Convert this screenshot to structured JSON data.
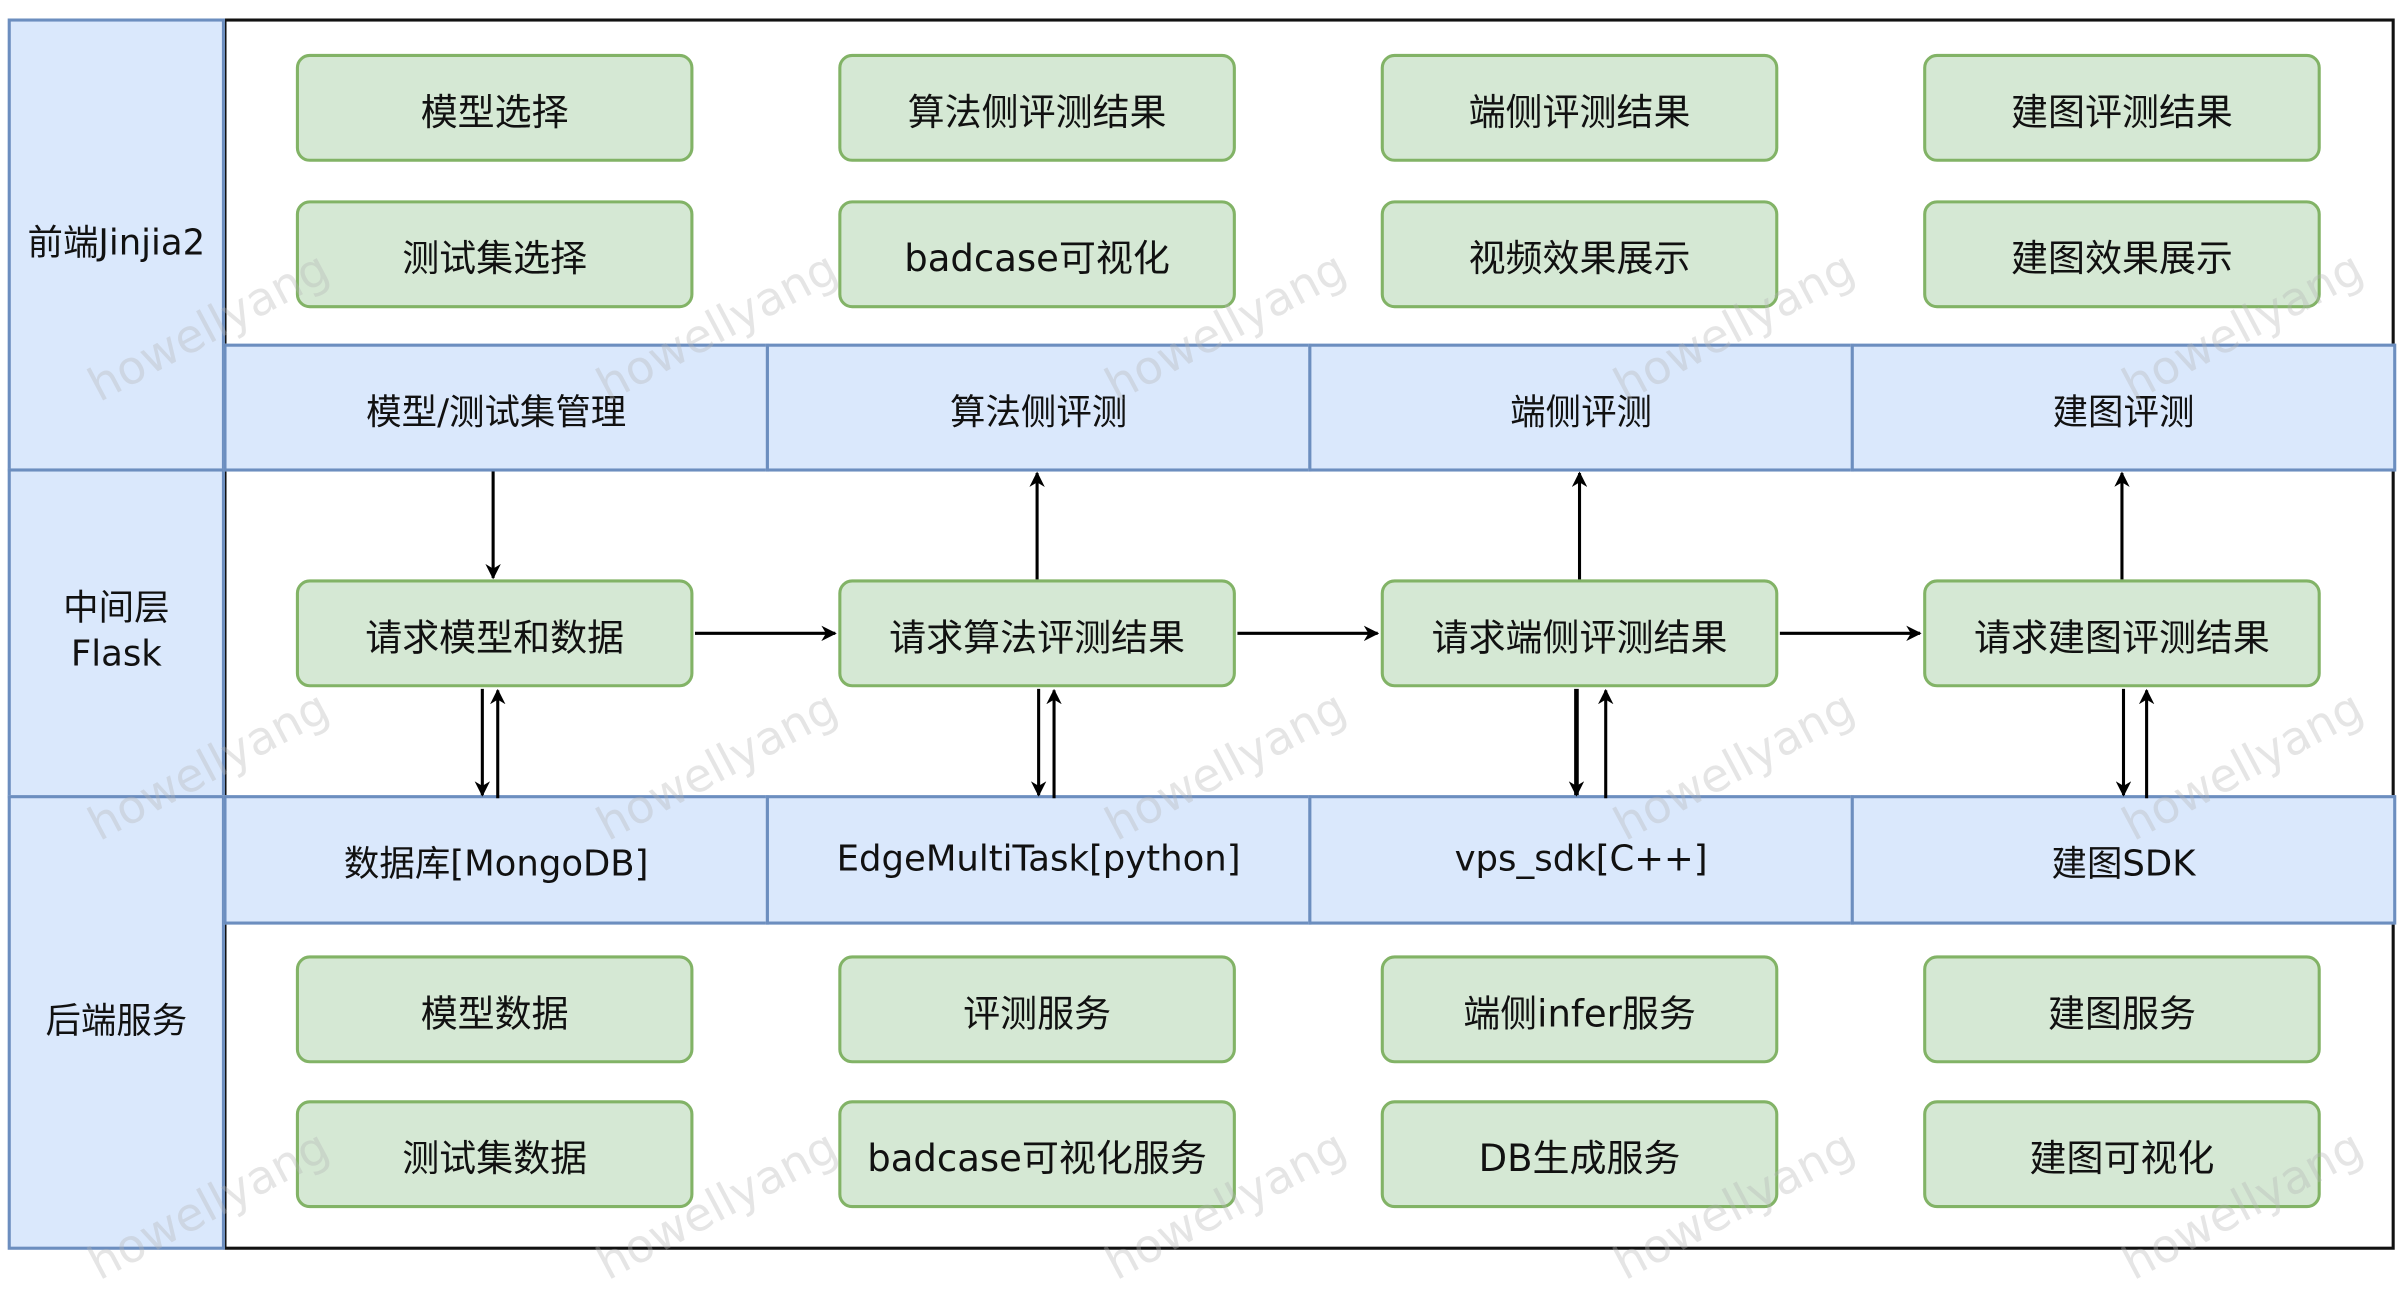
{
  "layers": {
    "frontend": "前端Jinjia2",
    "middle_line1": "中间层",
    "middle_line2": "Flask",
    "backend": "后端服务"
  },
  "frontend_boxes": [
    [
      "模型选择",
      "测试集选择"
    ],
    [
      "算法侧评测结果",
      "badcase可视化"
    ],
    [
      "端侧评测结果",
      "视频效果展示"
    ],
    [
      "建图评测结果",
      "建图效果展示"
    ]
  ],
  "frontend_band": [
    "模型/测试集管理",
    "算法侧评测",
    "端侧评测",
    "建图评测"
  ],
  "middle_boxes": [
    "请求模型和数据",
    "请求算法评测结果",
    "请求端侧评测结果",
    "请求建图评测结果"
  ],
  "backend_band": [
    "数据库[MongoDB]",
    "EdgeMultiTask[python]",
    "vps_sdk[C++]",
    "建图SDK"
  ],
  "backend_boxes": [
    [
      "模型数据",
      "测试集数据"
    ],
    [
      "评测服务",
      "badcase可视化服务"
    ],
    [
      "端侧infer服务",
      "DB生成服务"
    ],
    [
      "建图服务",
      "建图可视化"
    ]
  ],
  "watermark": "howellyang",
  "colors": {
    "layer_fill": "#dae8fc",
    "layer_stroke": "#6c8ebf",
    "box_fill": "#d5e8d4",
    "box_stroke": "#82b366"
  }
}
